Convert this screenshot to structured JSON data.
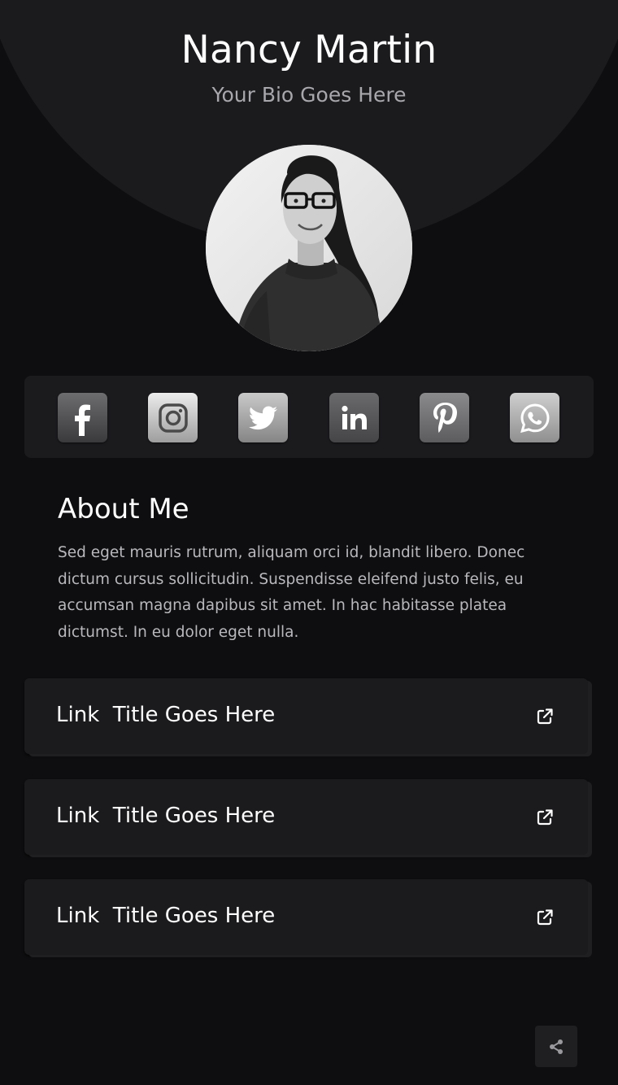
{
  "profile": {
    "name": "Nancy Martin",
    "bio": "Your Bio Goes Here"
  },
  "social": [
    {
      "name": "facebook",
      "icon": "facebook-icon"
    },
    {
      "name": "instagram",
      "icon": "instagram-icon"
    },
    {
      "name": "twitter",
      "icon": "twitter-icon"
    },
    {
      "name": "linkedin",
      "icon": "linkedin-icon"
    },
    {
      "name": "pinterest",
      "icon": "pinterest-icon"
    },
    {
      "name": "whatsapp",
      "icon": "whatsapp-icon"
    }
  ],
  "about": {
    "title": "About Me",
    "text": "Sed eget mauris rutrum, aliquam orci id, blandit libero. Donec dictum cursus sollicitudin. Suspendisse eleifend justo felis, eu accumsan magna dapibus sit amet. In hac habitasse platea dictumst. In eu dolor eget nulla."
  },
  "links": [
    {
      "label": "Link  Title Goes Here",
      "icon": "external-link-icon"
    },
    {
      "label": "Link  Title Goes Here",
      "icon": "external-link-icon"
    },
    {
      "label": "Link  Title Goes Here",
      "icon": "external-link-icon"
    }
  ],
  "share": {
    "icon": "share-icon"
  },
  "colors": {
    "background": "#0e0e10",
    "card": "#1b1b1e",
    "text": "#ffffff",
    "muted": "#a8a8ac"
  }
}
